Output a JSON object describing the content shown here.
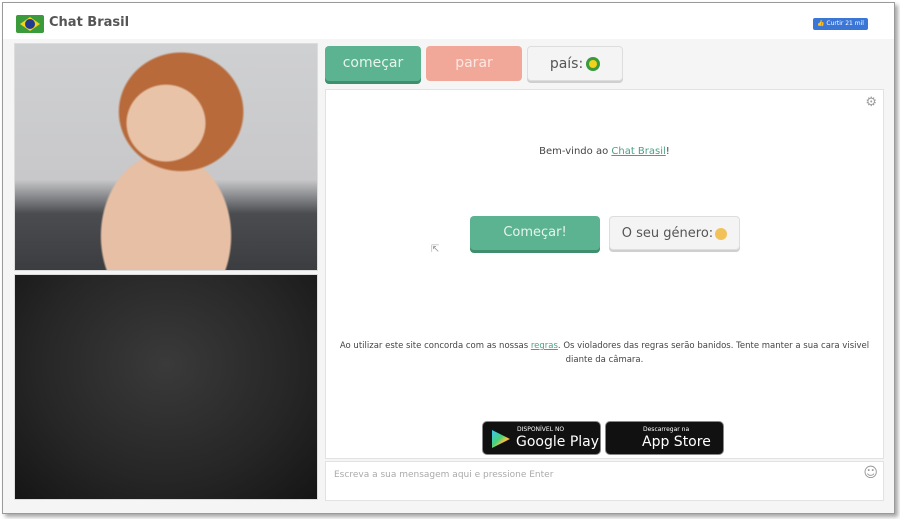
{
  "header": {
    "title": "Chat Brasil",
    "logo_icon": "brazil-flag-icon",
    "like_button": "👍 Curtir 21 mil"
  },
  "controls": {
    "start_label": "começar",
    "stop_label": "parar",
    "country_label": "país:",
    "country_icon": "brazil-flag-icon"
  },
  "panel": {
    "settings_icon": "gear-icon",
    "welcome_prefix": "Bem-vindo ao ",
    "welcome_link": "Chat Brasil",
    "welcome_suffix": "!",
    "begin_label": "Começar!",
    "gender_label": "O seu género:",
    "gender_icon": "face-emoji-icon",
    "terms_prefix": "Ao utilizar este site concorda com as nossas ",
    "terms_link": "regras",
    "terms_suffix": ". Os violadores das regras serão banidos. Tente manter a sua cara visivel diante da câmara.",
    "google_play": {
      "small": "DISPONÍVEL NO",
      "big": "Google Play"
    },
    "app_store": {
      "small": "Descarregar na",
      "big": "App Store"
    }
  },
  "chat": {
    "placeholder": "Escreva a sua mensagem aqui e pressione Enter",
    "value": "",
    "emoji_icon": "smiley-icon"
  },
  "colors": {
    "accent_green": "#5bb391",
    "stop_pink": "#f2a899",
    "like_blue": "#3b76d6",
    "link": "#4aa087"
  }
}
